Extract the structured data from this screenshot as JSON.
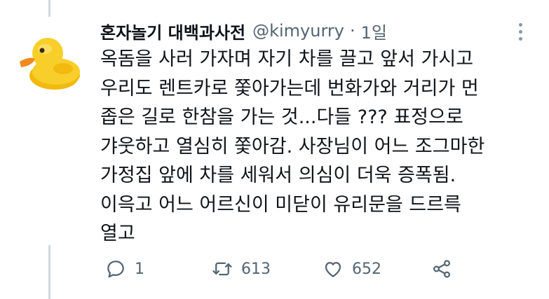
{
  "tweet": {
    "author_name": "혼자놀기 대백과사전",
    "handle": "@kimyurry",
    "separator": "·",
    "time": "1일",
    "lines": [
      "옥돔을 사러 가자며 자기 차를 끌고 앞서 가시고",
      "우리도 렌트카로 쫓아가는데 번화가와 거리가 먼",
      "좁은 길로 한참을 가는 것...다들 ??? 표정으로",
      "갸웃하고 열심히 쫓아감. 사장님이 어느 조그마한",
      "가정집 앞에 차를 세워서 의심이 더욱 증폭됨.",
      "이윽고 어느 어르신이 미닫이 유리문을 드르륵",
      "열고"
    ],
    "avatar_icon": "rubber-duck-icon"
  },
  "actions": {
    "reply_count": "1",
    "retweet_count": "613",
    "like_count": "652",
    "icons": [
      "reply-icon",
      "retweet-icon",
      "like-icon",
      "share-icon"
    ]
  },
  "colors": {
    "secondary_text": "#536471",
    "thread_line": "#cfd9de",
    "duck_yellow": "#f5c518",
    "duck_beak": "#f08a1c"
  }
}
